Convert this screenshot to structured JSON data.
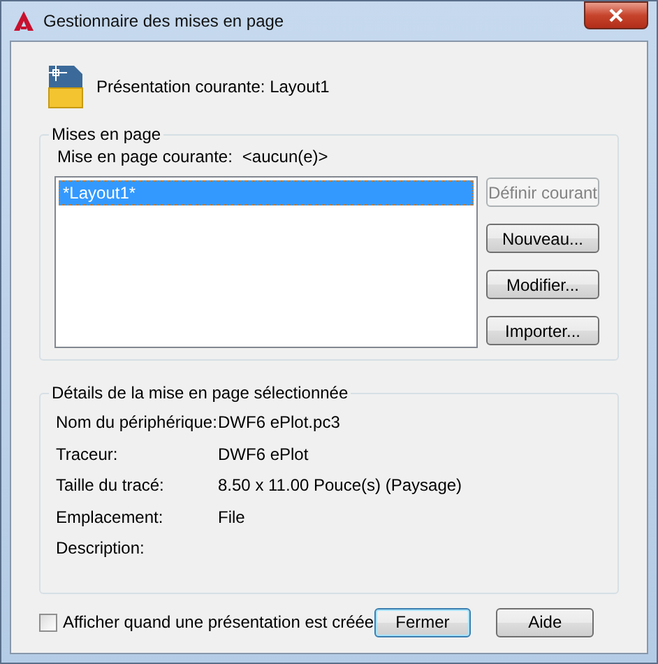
{
  "window": {
    "title": "Gestionnaire des mises en page"
  },
  "current_layout": {
    "label": "Présentation courante:",
    "value": "Layout1"
  },
  "page_setups": {
    "title": "Mises en page",
    "current_label": "Mise en page courante:",
    "current_value": "<aucun(e)>",
    "items": [
      {
        "label": "*Layout1*",
        "selected": true
      }
    ],
    "buttons": [
      {
        "label": "Définir courant",
        "disabled": true
      },
      {
        "label": "Nouveau...",
        "disabled": false
      },
      {
        "label": "Modifier...",
        "disabled": false
      },
      {
        "label": "Importer...",
        "disabled": false
      }
    ]
  },
  "details": {
    "title": "Détails de la mise en page sélectionnée",
    "rows": [
      {
        "label": "Nom du périphérique:",
        "value": "DWF6 ePlot.pc3"
      },
      {
        "label": "Traceur:",
        "value": "DWF6 ePlot"
      },
      {
        "label": "Taille du tracé:",
        "value": "8.50 x 11.00 Pouce(s) (Paysage)"
      },
      {
        "label": "Emplacement:",
        "value": "File"
      },
      {
        "label": "Description:"
      }
    ]
  },
  "show_on_create": {
    "label": "Afficher quand une présentation est créée",
    "checked": false
  },
  "buttons": [
    {
      "label": "Fermer",
      "default": true
    },
    {
      "label": "Aide",
      "default": false
    }
  ]
}
